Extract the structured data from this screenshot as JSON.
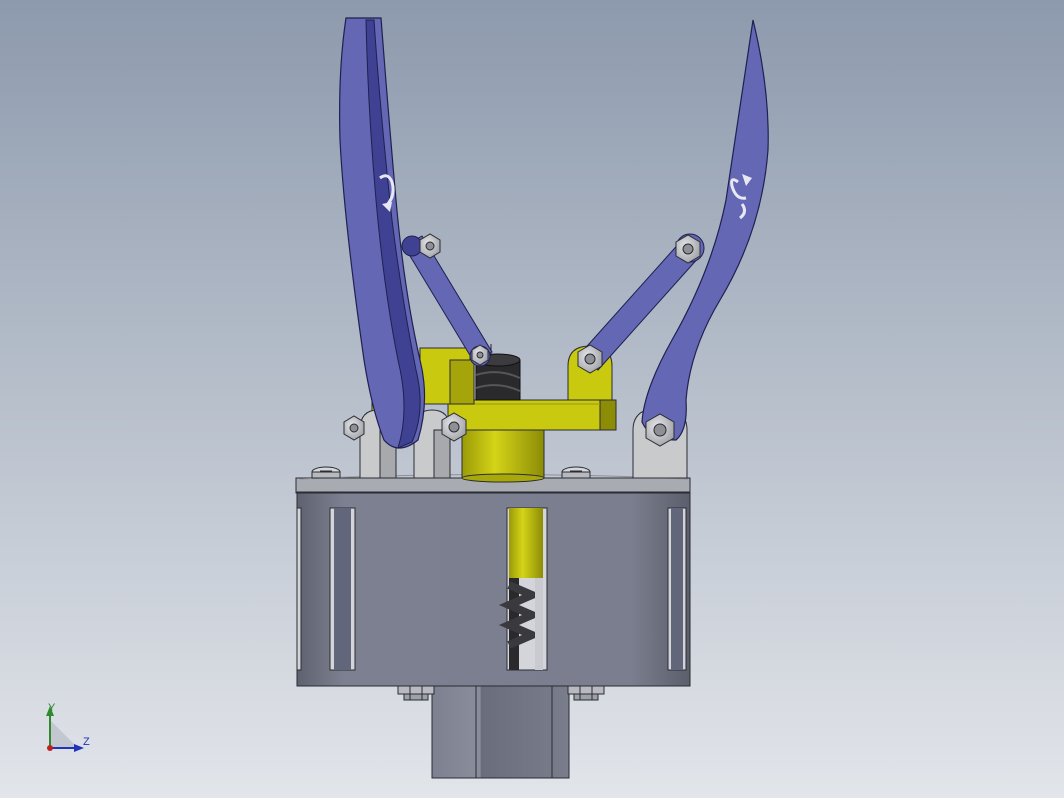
{
  "viewport": {
    "background_top": "#8d9aad",
    "background_bottom": "#e2e5ea"
  },
  "model": {
    "finger_color": "#6467b4",
    "finger_dark_color": "#3f4192",
    "body_color": "#c9c90f",
    "body_dark_color": "#8c8c07",
    "housing_color": "#7c8090",
    "housing_dark_color": "#5e6270",
    "bracket_color": "#c9cacc",
    "nut_color": "#bdbec2",
    "spring_color": "#2a2a2c",
    "finger_icons": [
      "rotate-arrow-icon",
      "rotate-arrow-icon"
    ]
  },
  "triad": {
    "y_label": "Y",
    "z_label": "Z",
    "y_color": "#2f8a2f",
    "z_color": "#2233bb",
    "x_color": "#c02020"
  }
}
